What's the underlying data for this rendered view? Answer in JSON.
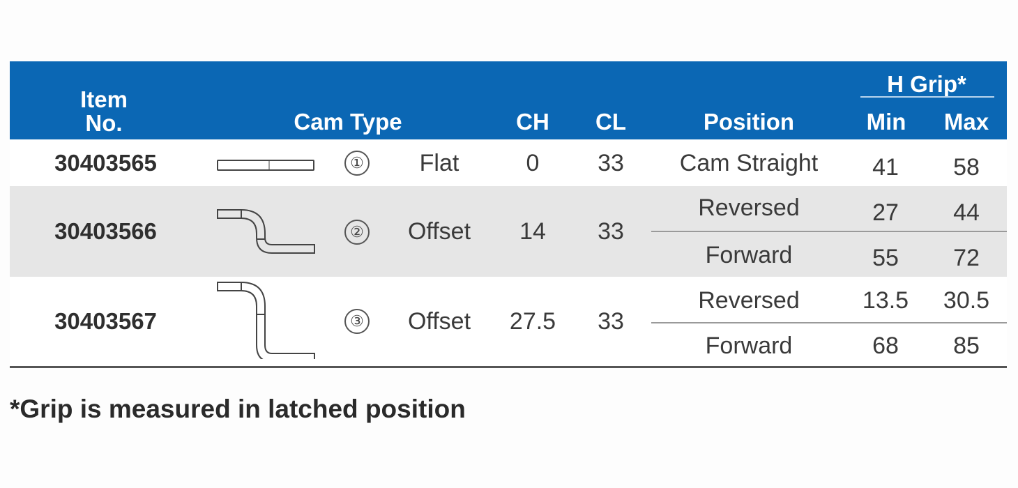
{
  "table": {
    "header": {
      "item_no": "Item No.",
      "item_line1": "Item",
      "item_line2": "No.",
      "cam_type": "Cam Type",
      "ch": "CH",
      "cl": "CL",
      "position": "Position",
      "h_grip": "H Grip*",
      "min": "Min",
      "max": "Max"
    },
    "colors": {
      "header_bg": "#0b67b4",
      "header_text": "#ffffff",
      "alt_row_bg": "#e6e6e6"
    },
    "rows": [
      {
        "item_no": "30403565",
        "cam_icon": "flat-cam-icon",
        "cam_number": "①",
        "cam_type": "Flat",
        "ch": "0",
        "cl": "33",
        "positions": [
          {
            "position": "Cam Straight",
            "min": "41",
            "max": "58"
          }
        ]
      },
      {
        "item_no": "30403566",
        "cam_icon": "short-offset-cam-icon",
        "cam_number": "②",
        "cam_type": "Offset",
        "ch": "14",
        "cl": "33",
        "positions": [
          {
            "position": "Reversed",
            "min": "27",
            "max": "44"
          },
          {
            "position": "Forward",
            "min": "55",
            "max": "72"
          }
        ]
      },
      {
        "item_no": "30403567",
        "cam_icon": "tall-offset-cam-icon",
        "cam_number": "③",
        "cam_type": "Offset",
        "ch": "27.5",
        "cl": "33",
        "positions": [
          {
            "position": "Reversed",
            "min": "13.5",
            "max": "30.5"
          },
          {
            "position": "Forward",
            "min": "68",
            "max": "85"
          }
        ]
      }
    ]
  },
  "footnote": "*Grip is measured in latched position"
}
